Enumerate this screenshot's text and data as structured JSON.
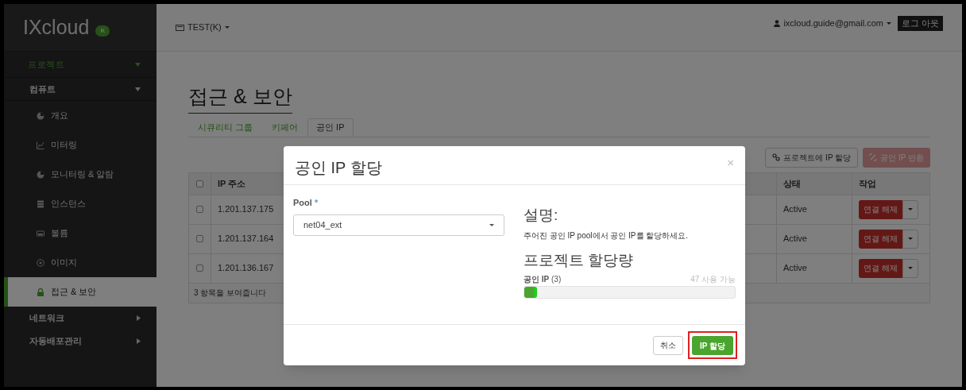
{
  "logo": {
    "text": "IXcloud",
    "badge": "K"
  },
  "header": {
    "project": "TEST(K)",
    "user": "ixcloud.guide@gmail.com",
    "logout": "로그 아웃"
  },
  "sidebar": {
    "items": [
      {
        "label": "프로젝트",
        "kind": "section",
        "expanded": true,
        "children": [
          {
            "label": "컴퓨트",
            "kind": "group",
            "expanded": true,
            "children": [
              {
                "label": "개요",
                "kind": "link",
                "selected": false
              },
              {
                "label": "미터링",
                "kind": "link",
                "selected": false
              },
              {
                "label": "모니터링 & 알람",
                "kind": "link",
                "selected": false
              },
              {
                "label": "인스턴스",
                "kind": "link",
                "selected": false
              },
              {
                "label": "볼륨",
                "kind": "link",
                "selected": false
              },
              {
                "label": "이미지",
                "kind": "link",
                "selected": false
              },
              {
                "label": "접근 & 보안",
                "kind": "link",
                "selected": true
              }
            ]
          },
          {
            "label": "네트워크",
            "kind": "group",
            "expanded": false
          },
          {
            "label": "자동배포관리",
            "kind": "group",
            "expanded": false
          }
        ]
      }
    ]
  },
  "page_title": "접근 & 보안",
  "tabs": [
    {
      "label": "시큐리티 그룹",
      "selected": false
    },
    {
      "label": "키페어",
      "selected": false
    },
    {
      "label": "공인 IP",
      "selected": true
    }
  ],
  "actions": [
    {
      "label": "프로젝트에 IP 할당",
      "kind": "default"
    },
    {
      "label": "공인 IP 반환",
      "kind": "danger"
    }
  ],
  "table": {
    "select_all_checked": false,
    "columns": [
      "IP 주소",
      "상태",
      "작업"
    ],
    "rows": [
      {
        "ip": "1.201.137.175",
        "status": "Active",
        "action": "연결 해제",
        "checked": false
      },
      {
        "ip": "1.201.137.164",
        "status": "Active",
        "action": "연결 해제",
        "checked": false
      },
      {
        "ip": "1.201.136.167",
        "status": "Active",
        "action": "연결 해제",
        "checked": false
      }
    ],
    "footer": "3 항목을 보여줍니다"
  },
  "modal": {
    "title": "공인 IP 할당",
    "close": "×",
    "pool": {
      "label": "Pool",
      "required": "*",
      "value": "net04_ext"
    },
    "description_title": "설명:",
    "description": "주어진 공인 IP pool에서 공인 IP를 할당하세요.",
    "quota_title": "프로젝트 할당량",
    "quota": {
      "label": "공인 IP",
      "count": "(3)",
      "available": "47 사용 가능",
      "level": 0.06
    },
    "buttons": [
      {
        "label": "취소",
        "kind": "default",
        "highlighted": false
      },
      {
        "label": "IP 할당",
        "kind": "primary",
        "highlighted": true
      }
    ]
  }
}
